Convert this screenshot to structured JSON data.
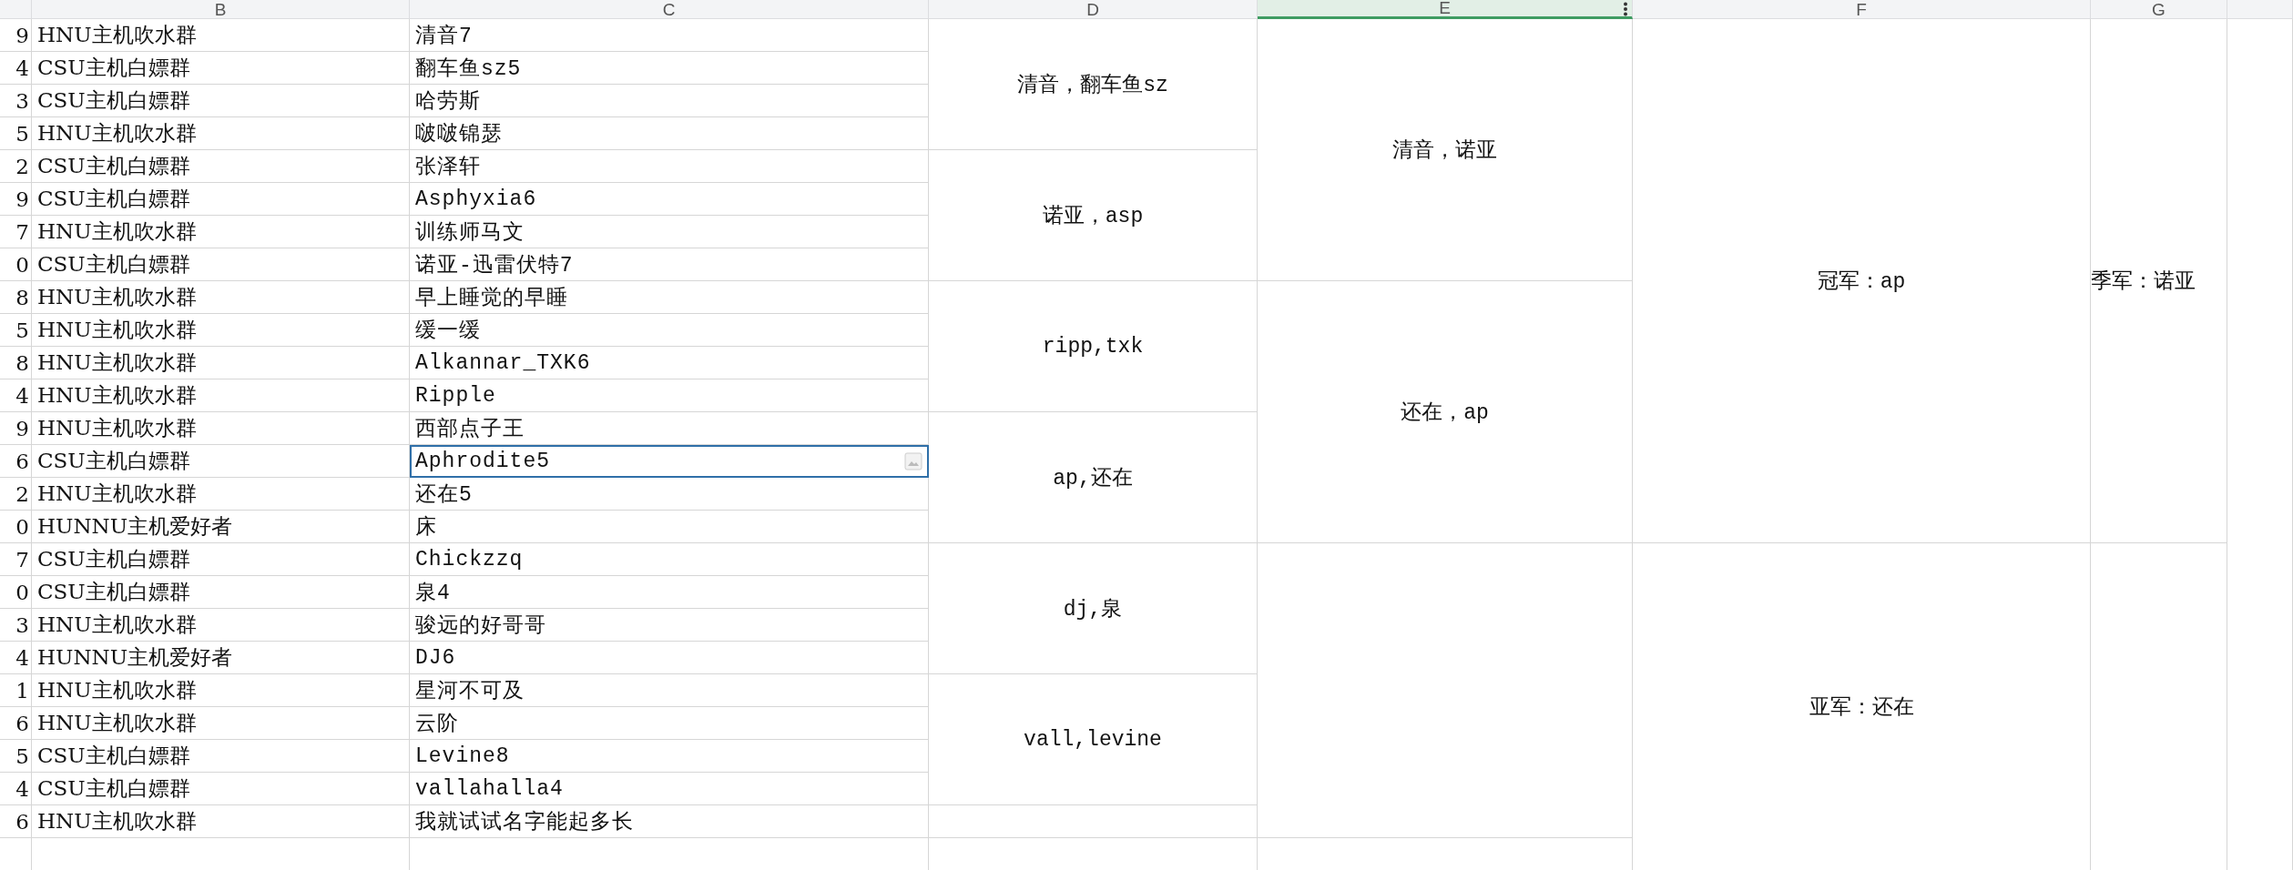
{
  "column_headers": [
    {
      "label": "B",
      "selected": false
    },
    {
      "label": "C",
      "selected": false
    },
    {
      "label": "D",
      "selected": false
    },
    {
      "label": "E",
      "selected": true
    },
    {
      "label": "F",
      "selected": false
    },
    {
      "label": "G",
      "selected": false
    }
  ],
  "rows": [
    {
      "a": "9",
      "b": "HNU主机吹水群",
      "c": "清音7",
      "selected": false
    },
    {
      "a": "4",
      "b": "CSU主机白嫖群",
      "c": "翻车鱼sz5",
      "selected": false
    },
    {
      "a": "3",
      "b": "CSU主机白嫖群",
      "c": "哈劳斯",
      "selected": false
    },
    {
      "a": "5",
      "b": "HNU主机吹水群",
      "c": "啵啵锦瑟",
      "selected": false
    },
    {
      "a": "2",
      "b": "CSU主机白嫖群",
      "c": "张泽轩",
      "selected": false
    },
    {
      "a": "9",
      "b": "CSU主机白嫖群",
      "c": "Asphyxia6",
      "selected": false
    },
    {
      "a": "7",
      "b": "HNU主机吹水群",
      "c": "训练师马文",
      "selected": false
    },
    {
      "a": "0",
      "b": "CSU主机白嫖群",
      "c": "诺亚-迅雷伏特7",
      "selected": false
    },
    {
      "a": "8",
      "b": "HNU主机吹水群",
      "c": "早上睡觉的早睡",
      "selected": false
    },
    {
      "a": "5",
      "b": "HNU主机吹水群",
      "c": "缓一缓",
      "selected": false
    },
    {
      "a": "8",
      "b": "HNU主机吹水群",
      "c": "Alkannar_TXK6",
      "selected": false
    },
    {
      "a": "4",
      "b": "HNU主机吹水群",
      "c": "Ripple",
      "selected": false
    },
    {
      "a": "9",
      "b": "HNU主机吹水群",
      "c": "西部点子王",
      "selected": false
    },
    {
      "a": "6",
      "b": "CSU主机白嫖群",
      "c": "Aphrodite5",
      "selected": true
    },
    {
      "a": "2",
      "b": "HNU主机吹水群",
      "c": "还在5",
      "selected": false
    },
    {
      "a": "0",
      "b": "HUNNU主机爱好者",
      "c": "床",
      "selected": false
    },
    {
      "a": "7",
      "b": "CSU主机白嫖群",
      "c": "Chickzzq",
      "selected": false
    },
    {
      "a": "0",
      "b": "CSU主机白嫖群",
      "c": "泉4",
      "selected": false
    },
    {
      "a": "3",
      "b": "HNU主机吹水群",
      "c": "骏远的好哥哥",
      "selected": false
    },
    {
      "a": "4",
      "b": "HUNNU主机爱好者",
      "c": "DJ6",
      "selected": false
    },
    {
      "a": "1",
      "b": "HNU主机吹水群",
      "c": "星河不可及",
      "selected": false
    },
    {
      "a": "6",
      "b": "HNU主机吹水群",
      "c": "云阶",
      "selected": false
    },
    {
      "a": "5",
      "b": "CSU主机白嫖群",
      "c": "Levine8",
      "selected": false
    },
    {
      "a": "4",
      "b": "CSU主机白嫖群",
      "c": "vallahalla4",
      "selected": false
    },
    {
      "a": "6",
      "b": "HNU主机吹水群",
      "c": "我就试试名字能起多长",
      "selected": false
    }
  ],
  "column_d": [
    "清音，翻车鱼sz",
    "诺亚，asp",
    "ripp,txk",
    "ap,还在",
    "dj,泉",
    "vall,levine"
  ],
  "column_e": [
    "清音，诺亚",
    "还在，ap"
  ],
  "column_f": [
    "冠军：ap",
    "亚军：还在"
  ],
  "column_g": [
    "季军：诺亚"
  ]
}
